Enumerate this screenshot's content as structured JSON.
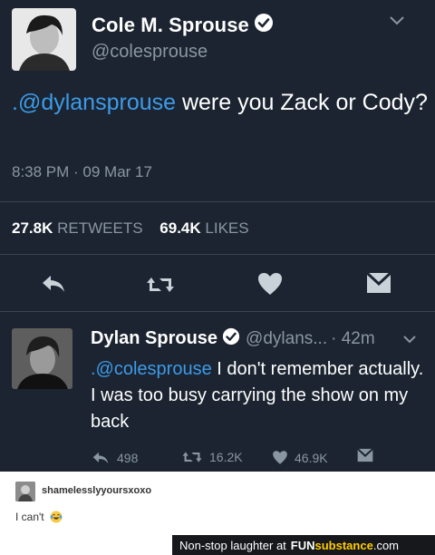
{
  "colors": {
    "background": "#1b2430",
    "mention": "#3d9be9",
    "muted": "#8a96a3",
    "verified_badge": "#ffffff"
  },
  "main_tweet": {
    "name": "Cole M. Sprouse",
    "handle": "@colesprouse",
    "text_mention": ".@dylansprouse",
    "text_rest": " were you Zack or Cody?",
    "timestamp": "8:38 PM · 09 Mar 17",
    "retweets_count": "27.8K",
    "retweets_label": "RETWEETS",
    "likes_count": "69.4K",
    "likes_label": "LIKES",
    "actions": [
      "reply-icon",
      "retweet-icon",
      "heart-icon",
      "message-icon"
    ]
  },
  "reply_tweet": {
    "name": "Dylan Sprouse",
    "handle": "@dylans...",
    "time": "· 42m",
    "text_mention": ".@colesprouse",
    "text_rest": " I don't remember actually. I was too busy carrying the show on my back",
    "reply_count": "498",
    "retweet_count": "16.2K",
    "like_count": "46.9K"
  },
  "comment": {
    "username": "shamelesslyyoursxoxo",
    "text": "I can't",
    "emoji": "laughing-tears-emoji"
  },
  "watermark": {
    "text": "Non-stop laughter at",
    "brand_fun": "FUN",
    "brand_sub": "substance",
    "brand_com": ".com"
  }
}
